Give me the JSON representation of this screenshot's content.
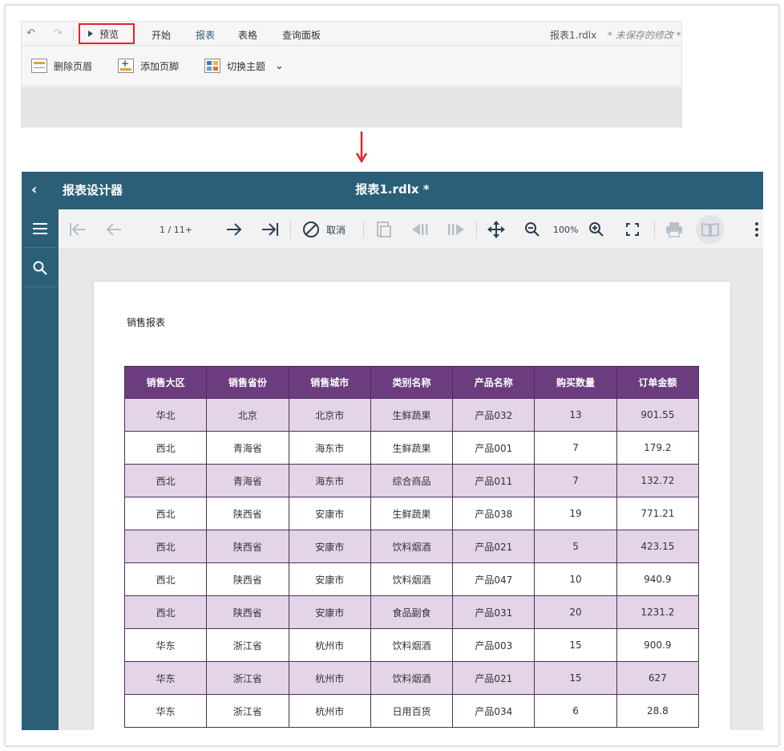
{
  "designer": {
    "preview_label": "预览",
    "tabs": [
      "开始",
      "报表",
      "表格",
      "查询面板"
    ],
    "active_tab": "报表",
    "file_name": "报表1.rdlx",
    "unsaved_note": "* 未保存的修改 *",
    "ribbon": {
      "delete_header": "删除页眉",
      "add_footer": "添加页脚",
      "switch_theme": "切换主题"
    }
  },
  "viewer": {
    "app_title": "报表设计器",
    "doc_title": "报表1.rdlx *",
    "toolbar": {
      "page_indicator": "1 / 11+",
      "cancel_label": "取消",
      "zoom": "100%"
    },
    "report_title": "销售报表",
    "columns": [
      "销售大区",
      "销售省份",
      "销售城市",
      "类别名称",
      "产品名称",
      "购买数量",
      "订单金额"
    ],
    "rows": [
      [
        "华北",
        "北京",
        "北京市",
        "生鲜蔬果",
        "产品032",
        "13",
        "901.55"
      ],
      [
        "西北",
        "青海省",
        "海东市",
        "生鲜蔬果",
        "产品001",
        "7",
        "179.2"
      ],
      [
        "西北",
        "青海省",
        "海东市",
        "综合商品",
        "产品011",
        "7",
        "132.72"
      ],
      [
        "西北",
        "陕西省",
        "安康市",
        "生鲜蔬果",
        "产品038",
        "19",
        "771.21"
      ],
      [
        "西北",
        "陕西省",
        "安康市",
        "饮料烟酒",
        "产品021",
        "5",
        "423.15"
      ],
      [
        "西北",
        "陕西省",
        "安康市",
        "饮料烟酒",
        "产品047",
        "10",
        "940.9"
      ],
      [
        "西北",
        "陕西省",
        "安康市",
        "食品副食",
        "产品031",
        "20",
        "1231.2"
      ],
      [
        "华东",
        "浙江省",
        "杭州市",
        "饮料烟酒",
        "产品003",
        "15",
        "900.9"
      ],
      [
        "华东",
        "浙江省",
        "杭州市",
        "饮料烟酒",
        "产品021",
        "15",
        "627"
      ],
      [
        "华东",
        "浙江省",
        "杭州市",
        "日用百货",
        "产品034",
        "6",
        "28.8"
      ]
    ]
  },
  "colors": {
    "viewer_header": "#2b5f78",
    "table_header": "#6b3c7e",
    "row_alt": "#e3d4e8",
    "highlight_box": "#e0242a",
    "arrow": "#d8262d"
  }
}
